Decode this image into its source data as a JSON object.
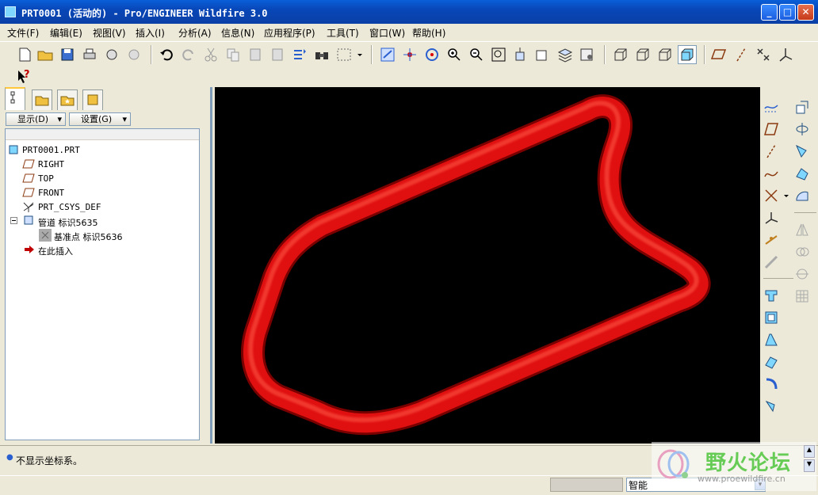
{
  "window": {
    "title": "PRT0001 (活动的) - Pro/ENGINEER Wildfire 3.0",
    "minimize": "_",
    "maximize": "□",
    "close": "✕"
  },
  "menu": [
    "文件(F)",
    "编辑(E)",
    "视图(V)",
    "插入(I)",
    "分析(A)",
    "信息(N)",
    "应用程序(P)",
    "工具(T)",
    "窗口(W)",
    "帮助(H)"
  ],
  "help_cursor": "?",
  "panel": {
    "display_label": "显示(D)",
    "settings_label": "设置(G)"
  },
  "tree": {
    "root": "PRT0001.PRT",
    "items": [
      "RIGHT",
      "TOP",
      "FRONT",
      "PRT_CSYS_DEF"
    ],
    "feature": "管道 标识5635",
    "subfeature": "基准点 标识5636",
    "insert_here": "在此插入"
  },
  "status": {
    "message": "不显示坐标系。",
    "filter": "智能"
  },
  "watermark": {
    "name": "野火论坛",
    "url": "www.proewildfire.cn"
  },
  "colors": {
    "pipe": "#e01010",
    "viewport": "#000000",
    "titlebar": "#0a5fd8"
  }
}
